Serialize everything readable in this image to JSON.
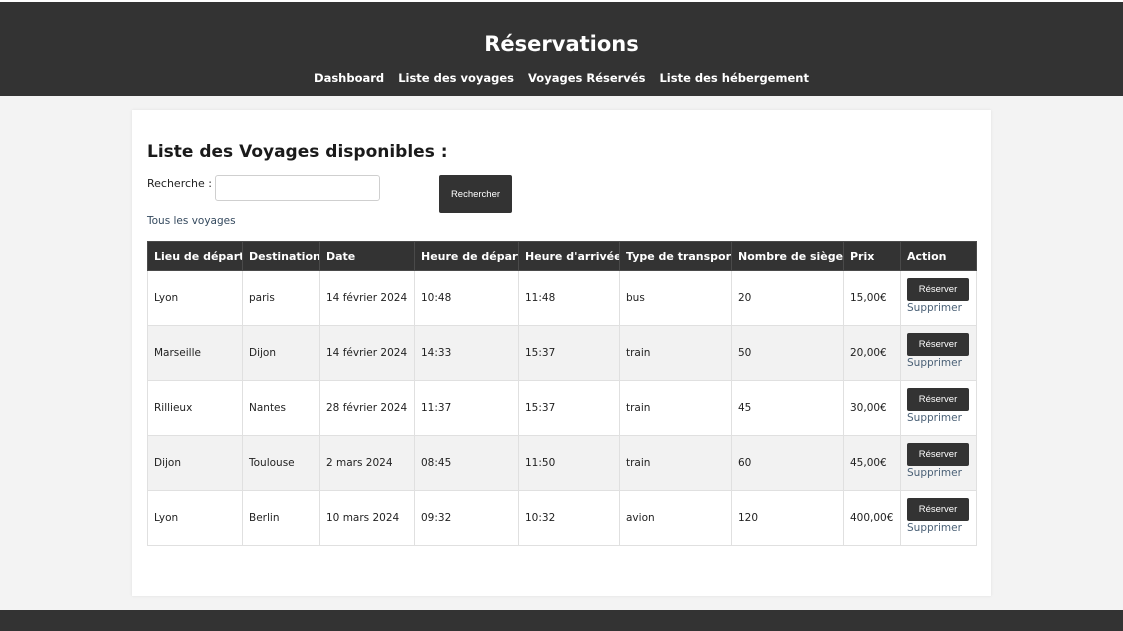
{
  "header": {
    "title": "Réservations",
    "nav": [
      "Dashboard",
      "Liste des voyages",
      "Voyages Réservés",
      "Liste des hébergement"
    ]
  },
  "main": {
    "heading": "Liste des Voyages disponibles :",
    "search_label": "Recherche :",
    "search_value": "",
    "search_button": "Rechercher",
    "all_link": "Tous les voyages",
    "columns": [
      "Lieu de départ",
      "Destination",
      "Date",
      "Heure de départ",
      "Heure d'arrivée",
      "Type de transport",
      "Nombre de sièges",
      "Prix",
      "Action"
    ],
    "rows": [
      [
        "Lyon",
        "paris",
        "14 février 2024",
        "10:48",
        "11:48",
        "bus",
        "20",
        "15,00€"
      ],
      [
        "Marseille",
        "Dijon",
        "14 février 2024",
        "14:33",
        "15:37",
        "train",
        "50",
        "20,00€"
      ],
      [
        "Rillieux",
        "Nantes",
        "28 février 2024",
        "11:37",
        "15:37",
        "train",
        "45",
        "30,00€"
      ],
      [
        "Dijon",
        "Toulouse",
        "2 mars 2024",
        "08:45",
        "11:50",
        "train",
        "60",
        "45,00€"
      ],
      [
        "Lyon",
        "Berlin",
        "10 mars 2024",
        "09:32",
        "10:32",
        "avion",
        "120",
        "400,00€"
      ]
    ],
    "reserve_label": "Réserver",
    "delete_label": "Supprimer"
  },
  "colors": {
    "header_bg": "#333333",
    "page_bg": "#f3f3f3",
    "link": "#34495e"
  }
}
